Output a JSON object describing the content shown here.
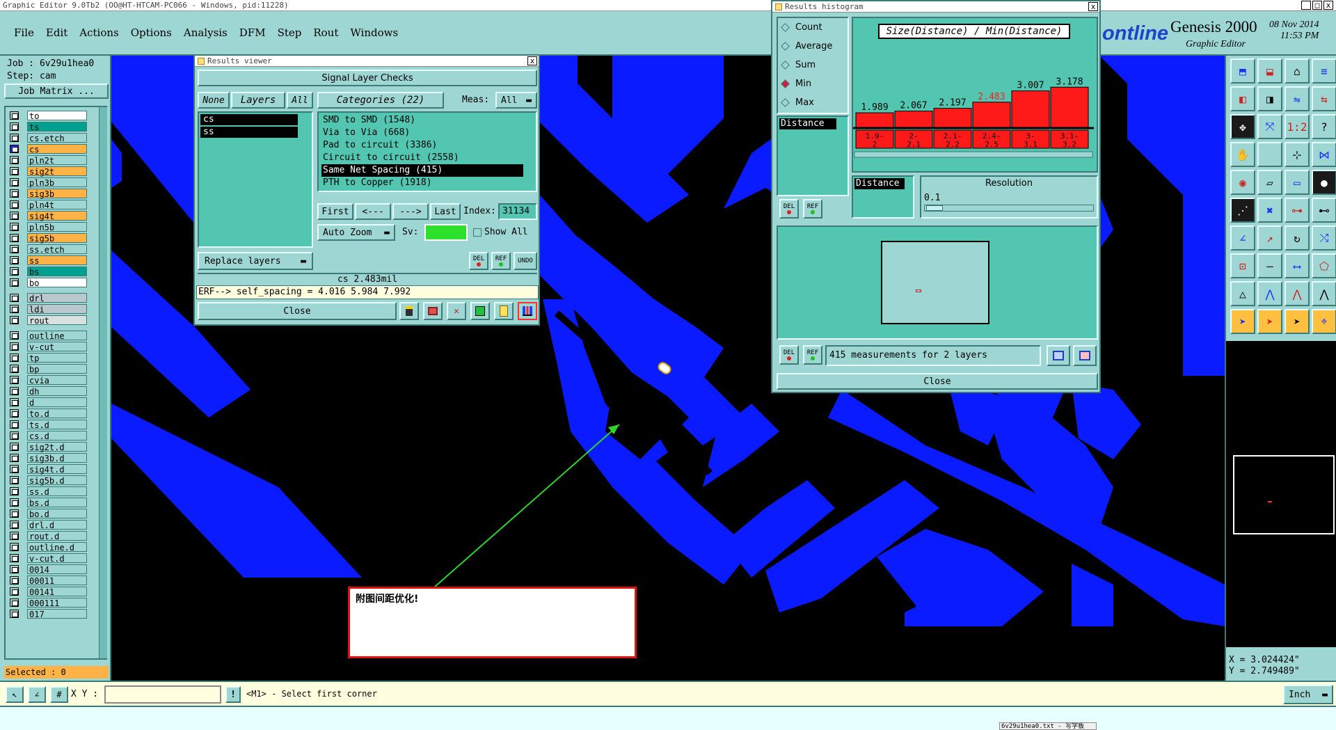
{
  "app": {
    "title": "Graphic Editor 9.0Tb2 (OO@HT-HTCAM-PC066 - Windows, pid:11228)",
    "menu": [
      "File",
      "Edit",
      "Actions",
      "Options",
      "Analysis",
      "DFM",
      "Step",
      "Rout",
      "Windows"
    ],
    "brand_partial": "ontline",
    "brand_name": "Genesis 2000",
    "brand_sub": "Graphic Editor",
    "date": "08 Nov 2014",
    "time": "11:53 PM"
  },
  "left": {
    "job": "Job : 6v29u1hea0",
    "step": "Step: cam",
    "job_matrix": "Job Matrix ...",
    "selected": "Selected : 0",
    "layers": [
      {
        "n": "to",
        "c": "#ffffff"
      },
      {
        "n": "ts",
        "c": "#00a090"
      },
      {
        "n": "cs.etch",
        "c": "#9dd6d3"
      },
      {
        "n": "cs",
        "c": "#ffb347",
        "active": true
      },
      {
        "n": "pln2t",
        "c": "#9dd6d3"
      },
      {
        "n": "sig2t",
        "c": "#ffb347"
      },
      {
        "n": "pln3b",
        "c": "#9dd6d3"
      },
      {
        "n": "sig3b",
        "c": "#ffb347"
      },
      {
        "n": "pln4t",
        "c": "#9dd6d3"
      },
      {
        "n": "sig4t",
        "c": "#ffb347"
      },
      {
        "n": "pln5b",
        "c": "#9dd6d3"
      },
      {
        "n": "sig5b",
        "c": "#ffb347"
      },
      {
        "n": "ss.etch",
        "c": "#9dd6d3"
      },
      {
        "n": "ss",
        "c": "#ffb347"
      },
      {
        "n": "bs",
        "c": "#00a090"
      },
      {
        "n": "bo",
        "c": "#ffffff"
      },
      {
        "n": "drl",
        "c": "#b8c8cc"
      },
      {
        "n": "ldi",
        "c": "#b8c8cc"
      },
      {
        "n": "rout",
        "c": "#d8e0e0"
      },
      {
        "n": "outline",
        "c": "#9dd6d3"
      },
      {
        "n": "v-cut",
        "c": "#9dd6d3"
      },
      {
        "n": "tp",
        "c": "#9dd6d3"
      },
      {
        "n": "bp",
        "c": "#9dd6d3"
      },
      {
        "n": "cvia",
        "c": "#9dd6d3"
      },
      {
        "n": "dh",
        "c": "#9dd6d3"
      },
      {
        "n": "d",
        "c": "#9dd6d3"
      },
      {
        "n": "to.d",
        "c": "#9dd6d3"
      },
      {
        "n": "ts.d",
        "c": "#9dd6d3"
      },
      {
        "n": "cs.d",
        "c": "#9dd6d3"
      },
      {
        "n": "sig2t.d",
        "c": "#9dd6d3"
      },
      {
        "n": "sig3b.d",
        "c": "#9dd6d3"
      },
      {
        "n": "sig4t.d",
        "c": "#9dd6d3"
      },
      {
        "n": "sig5b.d",
        "c": "#9dd6d3"
      },
      {
        "n": "ss.d",
        "c": "#9dd6d3"
      },
      {
        "n": "bs.d",
        "c": "#9dd6d3"
      },
      {
        "n": "bo.d",
        "c": "#9dd6d3"
      },
      {
        "n": "drl.d",
        "c": "#9dd6d3"
      },
      {
        "n": "rout.d",
        "c": "#9dd6d3"
      },
      {
        "n": "outline.d",
        "c": "#9dd6d3"
      },
      {
        "n": "v-cut.d",
        "c": "#9dd6d3"
      },
      {
        "n": "0014",
        "c": "#9dd6d3"
      },
      {
        "n": "00011",
        "c": "#9dd6d3"
      },
      {
        "n": "00141",
        "c": "#9dd6d3"
      },
      {
        "n": "000111",
        "c": "#9dd6d3"
      },
      {
        "n": "017",
        "c": "#9dd6d3"
      }
    ]
  },
  "viewer": {
    "title": "Results viewer",
    "header": "Signal Layer Checks",
    "none": "None",
    "layers_lbl": "Layers",
    "all": "All",
    "categories": "Categories (22)",
    "meas": "Meas:",
    "meas_val": "All",
    "layer_list": [
      "cs",
      "ss"
    ],
    "cats": [
      "SMD to SMD (1548)",
      "Via to Via (668)",
      "Pad to circuit (3386)",
      "Circuit to circuit (2558)",
      "Same Net Spacing (415)",
      "PTH to Copper (1918)"
    ],
    "first": "First",
    "prev": "<---",
    "next": "--->",
    "last": "Last",
    "index": "Index:",
    "index_val": "31134",
    "auto_zoom": "Auto Zoom",
    "sv": "Sv:",
    "show_all": "Show All",
    "replace": "Replace layers",
    "del": "DEL",
    "ref": "REF",
    "undo": "UNDO",
    "status": "cs 2.483mil",
    "erf": "ERF--> self_spacing = 4.016 5.984 7.992",
    "close": "Close"
  },
  "hist": {
    "title": "Results histogram",
    "radios": [
      "Count",
      "Average",
      "Sum",
      "Min",
      "Max"
    ],
    "selected": "Min",
    "chart_title": "Size(Distance) / Min(Distance)",
    "attr": "Distance",
    "attr2": "Distance",
    "resolution": "Resolution",
    "res_val": "0.1",
    "summary": "415 measurements for 2 layers",
    "close": "Close",
    "del": "DEL",
    "ref": "REF"
  },
  "chart_data": {
    "type": "bar",
    "title": "Size(Distance) / Min(Distance)",
    "categories": [
      "1.9-2",
      "2-2.1",
      "2.1-2.2",
      "2.4-2.5",
      "3-3.1",
      "3.1-3.2"
    ],
    "values": [
      1.989,
      2.067,
      2.197,
      2.483,
      3.007,
      3.178
    ],
    "highlight_index": 3,
    "bar_color": "#ff1a1a",
    "highlight_label_color": "#ff1a1a"
  },
  "note": {
    "text": "附图间距优化!"
  },
  "bottom": {
    "xy": "X Y :",
    "prompt": "<M1> - Select first corner",
    "unit": "Inch",
    "coord_x": "X = 3.024424\"",
    "coord_y": "Y = 2.749489\"",
    "taskbar": "6v29u1hea0.txt - 写字板"
  }
}
